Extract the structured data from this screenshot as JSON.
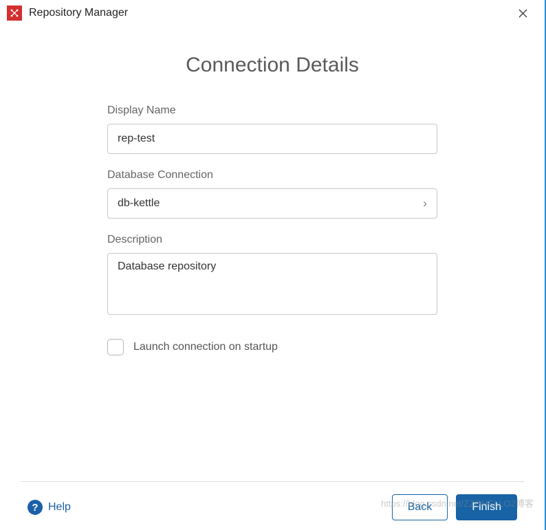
{
  "titlebar": {
    "title": "Repository Manager"
  },
  "page": {
    "title": "Connection Details"
  },
  "form": {
    "displayName": {
      "label": "Display Name",
      "value": "rep-test"
    },
    "dbConnection": {
      "label": "Database Connection",
      "value": "db-kettle"
    },
    "description": {
      "label": "Description",
      "value": "Database repository"
    },
    "launchOnStartup": {
      "label": "Launch connection on startup",
      "checked": false
    }
  },
  "footer": {
    "help": "Help",
    "back": "Back",
    "finish": "Finish"
  },
  "watermark": "https://blog.csdn.net/ZZQHELLO2博客"
}
